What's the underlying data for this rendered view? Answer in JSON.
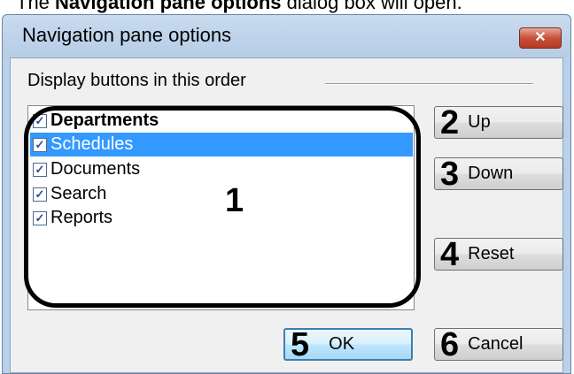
{
  "caption": {
    "prefix": "The ",
    "bold": "Navigation pane options",
    "suffix": " dialog box will open."
  },
  "window": {
    "title": "Navigation pane options",
    "close_symbol": "✕"
  },
  "group_label": "Display buttons in this order",
  "list": {
    "items": [
      {
        "label": "Departments",
        "checked": true,
        "selected": false,
        "bold": true
      },
      {
        "label": "Schedules",
        "checked": true,
        "selected": true,
        "bold": false
      },
      {
        "label": "Documents",
        "checked": true,
        "selected": false,
        "bold": false
      },
      {
        "label": "Search",
        "checked": true,
        "selected": false,
        "bold": false
      },
      {
        "label": "Reports",
        "checked": true,
        "selected": false,
        "bold": false
      }
    ],
    "check_mark": "✓"
  },
  "callouts": {
    "list": "1",
    "up": "2",
    "down": "3",
    "reset": "4",
    "ok": "5",
    "cancel": "6"
  },
  "buttons": {
    "up": "Up",
    "down": "Down",
    "reset": "Reset",
    "ok": "OK",
    "cancel": "Cancel"
  },
  "colors": {
    "selection": "#3399ff",
    "window_frame": "#b9d1ea",
    "close_button": "#c8503a",
    "client": "#f0f0f0"
  }
}
